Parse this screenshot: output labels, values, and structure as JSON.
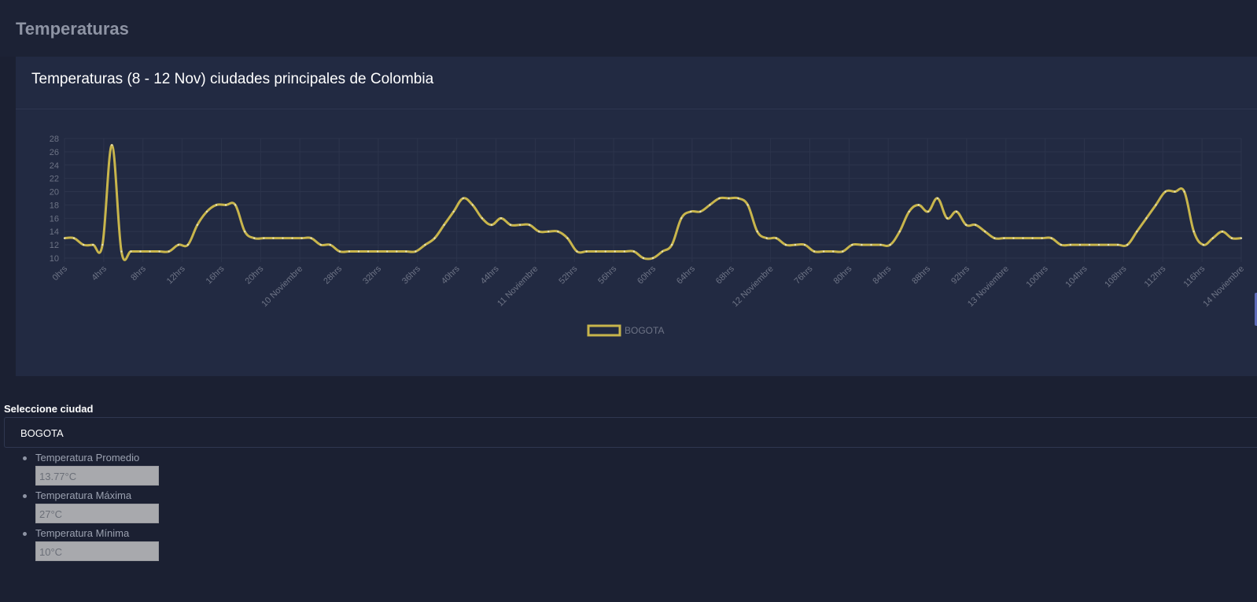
{
  "page": {
    "title": "Temperaturas"
  },
  "card": {
    "title": "Temperaturas (8 - 12 Nov) ciudades principales de Colombia"
  },
  "colors": {
    "series": "#c8b54c",
    "point": "#e6e0b8",
    "grid": "#2c344c",
    "tick": "#6d7385",
    "background": "#1b2032",
    "card": "#222a42"
  },
  "chart_data": {
    "type": "line",
    "title": "",
    "xlabel": "",
    "ylabel": "",
    "ylim": [
      10,
      28
    ],
    "y_ticks": [
      10,
      12,
      14,
      16,
      18,
      20,
      22,
      24,
      26,
      28
    ],
    "grid": true,
    "legend_position": "bottom",
    "x_ticks": [
      "0hrs",
      "4hrs",
      "8hrs",
      "12hrs",
      "16hrs",
      "20hrs",
      "10 Noviembre",
      "28hrs",
      "32hrs",
      "36hrs",
      "40hrs",
      "44hrs",
      "11 Noviembre",
      "52hrs",
      "56hrs",
      "60hrs",
      "64hrs",
      "68hrs",
      "12 Noviembre",
      "76hrs",
      "80hrs",
      "84hrs",
      "88hrs",
      "92hrs",
      "13 Noviembre",
      "100hrs",
      "104hrs",
      "108hrs",
      "112hrs",
      "116hrs",
      "14 Noviembre"
    ],
    "series": [
      {
        "name": "BOGOTA",
        "values": [
          13,
          13,
          12,
          12,
          12,
          27,
          11,
          11,
          11,
          11,
          11,
          11,
          12,
          12,
          15,
          17,
          18,
          18,
          18,
          14,
          13,
          13,
          13,
          13,
          13,
          13,
          13,
          12,
          12,
          11,
          11,
          11,
          11,
          11,
          11,
          11,
          11,
          11,
          12,
          13,
          15,
          17,
          19,
          18,
          16,
          15,
          16,
          15,
          15,
          15,
          14,
          14,
          14,
          13,
          11,
          11,
          11,
          11,
          11,
          11,
          11,
          10,
          10,
          11,
          12,
          16,
          17,
          17,
          18,
          19,
          19,
          19,
          18,
          14,
          13,
          13,
          12,
          12,
          12,
          11,
          11,
          11,
          11,
          12,
          12,
          12,
          12,
          12,
          14,
          17,
          18,
          17,
          19,
          16,
          17,
          15,
          15,
          14,
          13,
          13,
          13,
          13,
          13,
          13,
          13,
          12,
          12,
          12,
          12,
          12,
          12,
          12,
          12,
          14,
          16,
          18,
          20,
          20,
          20,
          14,
          12,
          13,
          14,
          13,
          13
        ]
      }
    ]
  },
  "city_select": {
    "label": "Seleccione ciudad",
    "value": "BOGOTA"
  },
  "stats": [
    {
      "label": "Temperatura Promedio",
      "value": "13.77°C"
    },
    {
      "label": "Temperatura Máxima",
      "value": "27°C"
    },
    {
      "label": "Temperatura Mínima",
      "value": "10°C"
    }
  ]
}
